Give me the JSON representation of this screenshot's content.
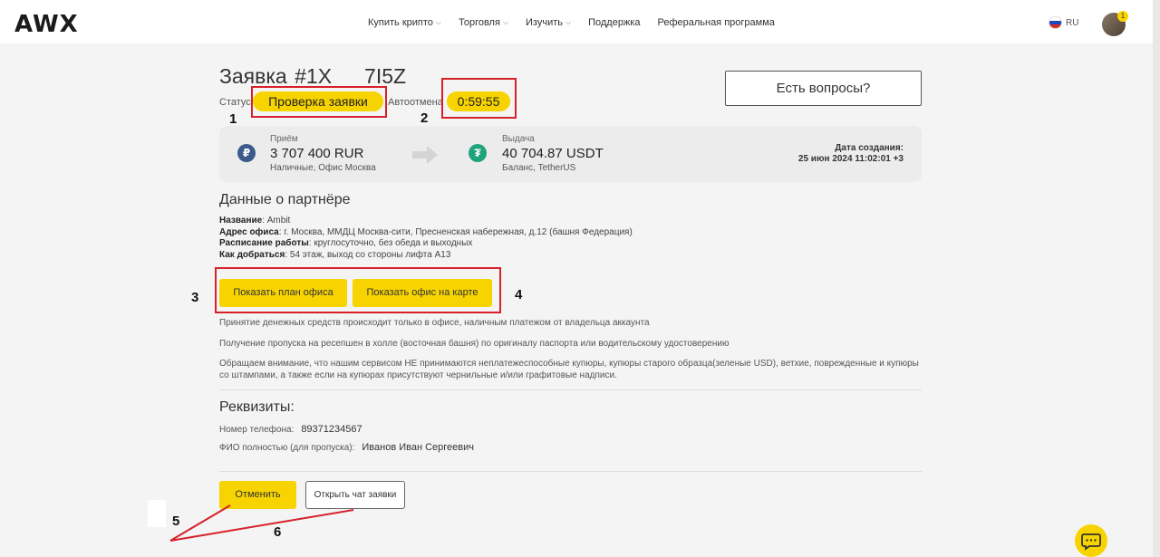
{
  "header": {
    "logo": "AWX",
    "nav": [
      {
        "label": "Купить крипто",
        "has_dropdown": true
      },
      {
        "label": "Торговля",
        "has_dropdown": true
      },
      {
        "label": "Изучить",
        "has_dropdown": true
      },
      {
        "label": "Поддержка",
        "has_dropdown": false
      },
      {
        "label": "Реферальная программа",
        "has_dropdown": false
      }
    ],
    "lang": "RU",
    "avatar_badge": "1"
  },
  "order": {
    "title_prefix": "Заявка #1X",
    "title_suffix": "7I5Z",
    "status_label": "Статус",
    "status_value": "Проверка заявки",
    "auto_cancel_label": "Автоотмена",
    "timer": "0:59:55",
    "questions_button": "Есть вопросы?"
  },
  "exchange": {
    "receive_label": "Приём",
    "receive_amount": "3 707 400 RUR",
    "receive_method": "Наличные, Офис Москва",
    "give_label": "Выдача",
    "give_amount": "40 704.87 USDT",
    "give_method": "Баланс, TetherUS",
    "created_label": "Дата создания:",
    "created_value": "25 июн 2024 11:02:01 +3"
  },
  "partner": {
    "title": "Данные о партнёре",
    "lines": [
      {
        "key": "Название",
        "value": ": Ambit"
      },
      {
        "key": "Адрес офиса",
        "value": ": г. Москва, ММДЦ Москва-сити, Пресненская набережная, д.12 (башня Федерация)"
      },
      {
        "key": "Расписание работы",
        "value": ": круглосуточно, без обеда и выходных"
      },
      {
        "key": "Как добраться",
        "value": ": 54 этаж, выход со стороны лифта А13"
      }
    ],
    "btn_office_plan": "Показать план офиса",
    "btn_office_map": "Показать офис на карте",
    "notes": [
      "Принятие денежных средств происходит только в офисе, наличным платежом от владельца аккаунта",
      "Получение пропуска на ресепшен в холле (восточная башня) по оригиналу паспорта или водительскому удостоверению",
      "Обращаем внимание, что нашим сервисом НЕ принимаются неплатежеспособные купюры, купюры старого образца(зеленые USD), ветхие, поврежденные и купюры со штампами, а также если на купюрах присутствуют чернильные и/или графитовые надписи."
    ]
  },
  "requisites": {
    "title": "Реквизиты:",
    "phone_label": "Номер телефона:",
    "phone_value": "89371234567",
    "name_label": "ФИО полностью (для пропуска):",
    "name_value": "Иванов Иван Сергеевич"
  },
  "actions": {
    "cancel": "Отменить",
    "open_chat": "Открыть чат заявки"
  },
  "annotations": [
    "1",
    "2",
    "3",
    "4",
    "5",
    "6"
  ],
  "colors": {
    "accent_yellow": "#f7d400",
    "annotation_red": "#d6202a",
    "rub_coin": "#3d5a8c",
    "usdt_coin": "#1fa37a"
  }
}
